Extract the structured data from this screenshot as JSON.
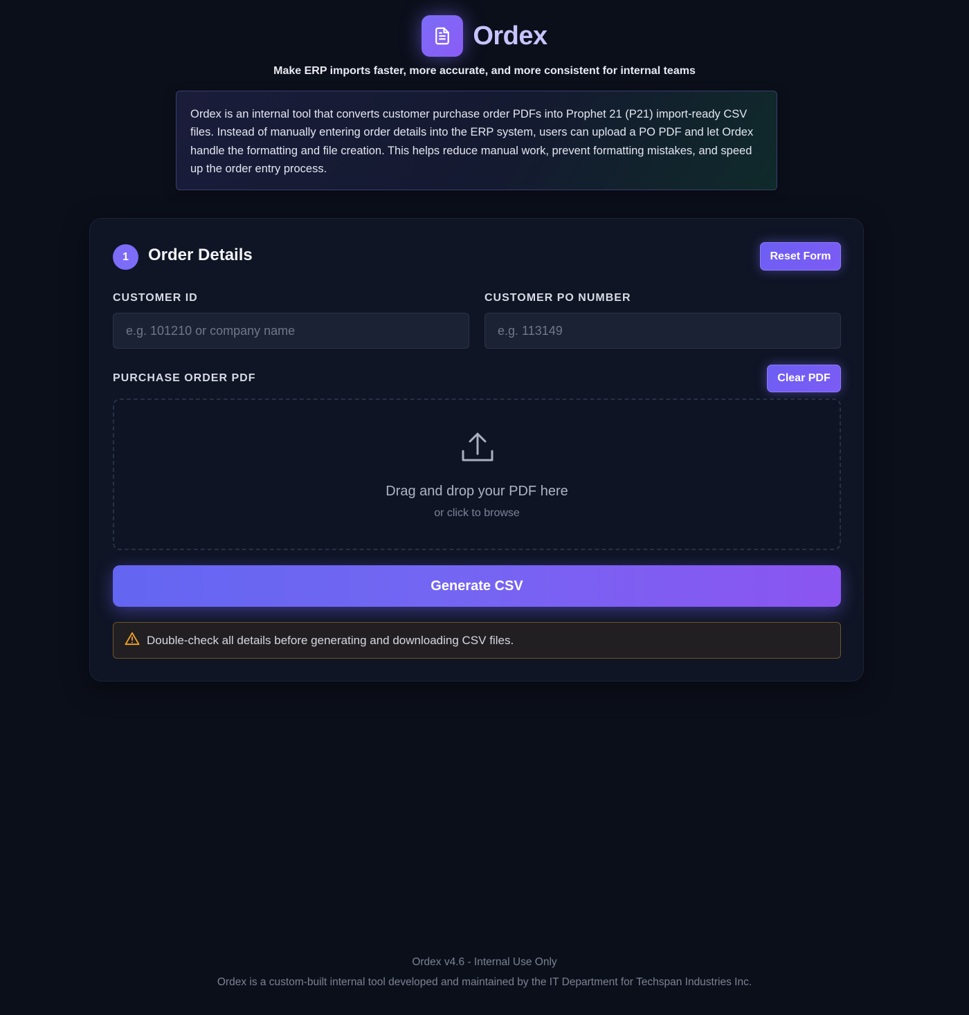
{
  "app": {
    "title": "Ordex",
    "logo_icon": "document-icon",
    "tagline": "Make ERP imports faster, more accurate, and more consistent for internal teams",
    "description": "Ordex is an internal tool that converts customer purchase order PDFs into Prophet 21 (P21) import-ready CSV files. Instead of manually entering order details into the ERP system, users can upload a PO PDF and let Ordex handle the formatting and file creation. This helps reduce manual work, prevent formatting mistakes, and speed up the order entry process."
  },
  "card": {
    "step": "1",
    "title": "Order Details",
    "reset_label": "Reset Form"
  },
  "form": {
    "customer_id": {
      "label": "CUSTOMER ID",
      "placeholder": "e.g. 101210 or company name",
      "value": ""
    },
    "po_number": {
      "label": "CUSTOMER PO NUMBER",
      "placeholder": "e.g. 113149",
      "value": ""
    },
    "pdf": {
      "label": "PURCHASE ORDER PDF",
      "clear_label": "Clear PDF",
      "drop_icon": "upload-icon",
      "drop_title": "Drag and drop your PDF here",
      "drop_subtitle": "or click to browse"
    },
    "generate_label": "Generate CSV",
    "warning_icon": "warning-icon",
    "warning_text": "Double-check all details before generating and downloading CSV files."
  },
  "footer": {
    "version": "Ordex v4.6 - Internal Use Only",
    "note": "Ordex is a custom-built internal tool developed and maintained by the IT Department for Techspan Industries Inc."
  },
  "colors": {
    "background": "#0b0f1a",
    "accent": "#7c6cf7",
    "card": "#0f1525",
    "warning_border": "#6e5524",
    "warning_icon": "#f5a524"
  }
}
